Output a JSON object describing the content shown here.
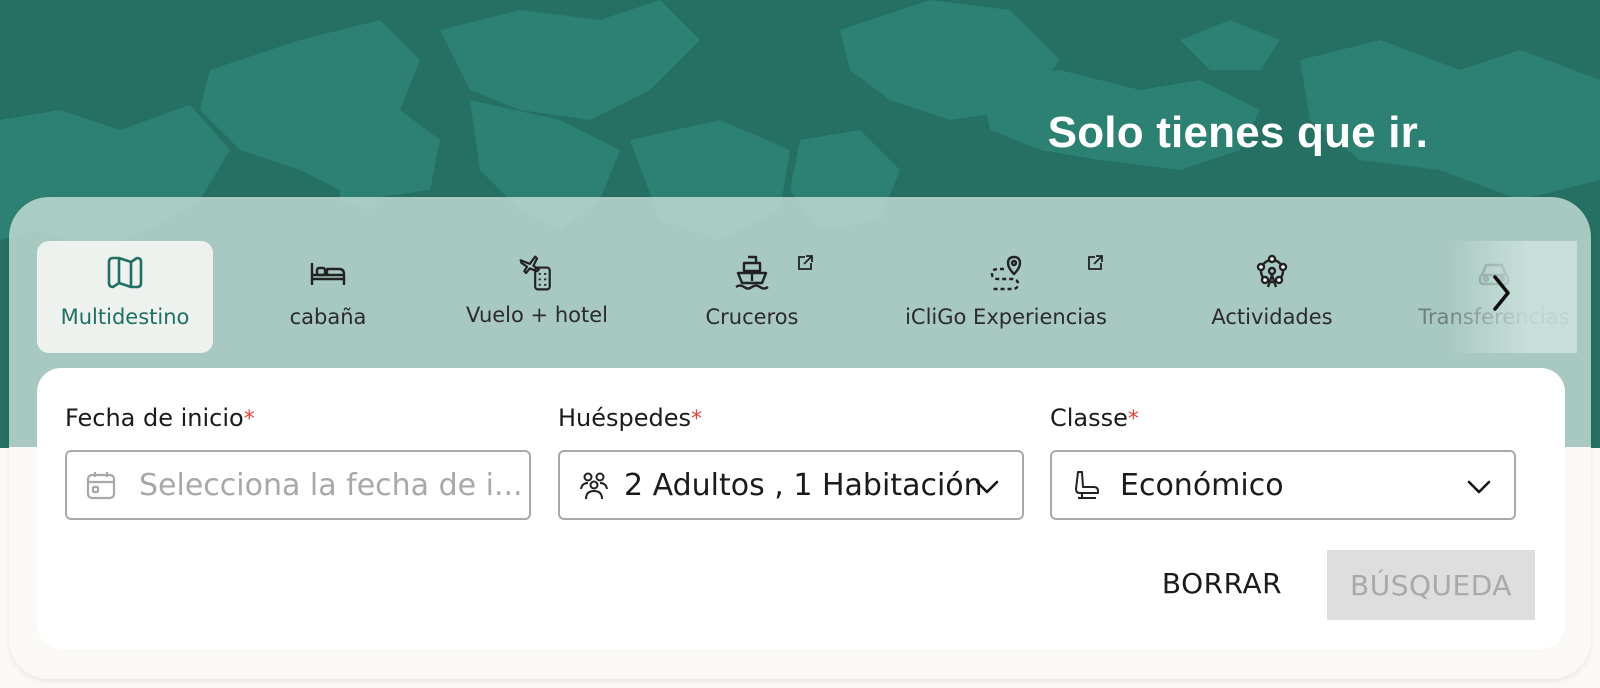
{
  "hero": {
    "tagline": "Solo tienes que ir."
  },
  "tabs": [
    {
      "label": "Multidestino",
      "icon": "map-icon",
      "active": true
    },
    {
      "label": "cabaña",
      "icon": "bed-icon"
    },
    {
      "label": "Vuelo + hotel",
      "icon": "flight-hotel-icon"
    },
    {
      "label": "Cruceros",
      "icon": "ship-icon",
      "external": true
    },
    {
      "label": "iCliGo Experiencias",
      "icon": "route-icon",
      "external": true
    },
    {
      "label": "Actividades",
      "icon": "ferris-wheel-icon"
    },
    {
      "label": "Transferencias",
      "icon": "car-icon"
    }
  ],
  "form": {
    "start_date": {
      "label": "Fecha de inicio",
      "required_mark": "*",
      "placeholder": "Selecciona la fecha de i..."
    },
    "guests": {
      "label": "Huéspedes",
      "required_mark": "*",
      "value": "2 Adultos , 1 Habitación"
    },
    "class": {
      "label": "Classe",
      "required_mark": "*",
      "value": "Económico"
    },
    "clear_label": "BORRAR",
    "search_label": "BÚSQUEDA"
  },
  "colors": {
    "brand": "#256f63",
    "required": "#e0443b",
    "disabled": "#dedede"
  }
}
